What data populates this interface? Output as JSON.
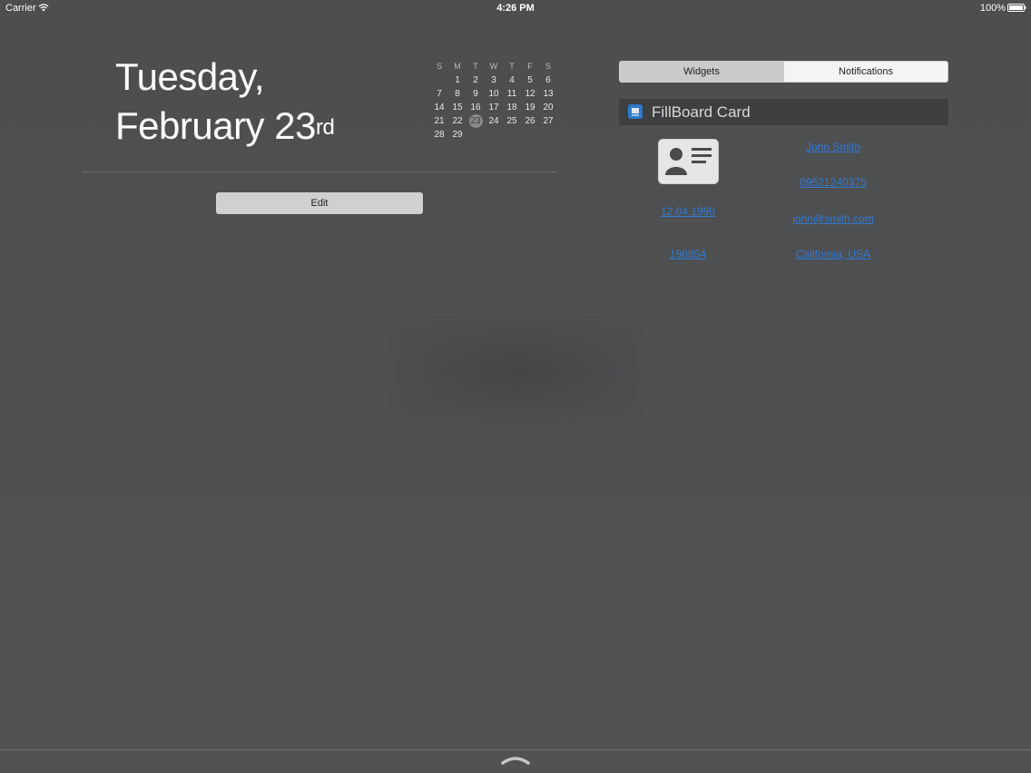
{
  "status_bar": {
    "carrier": "Carrier",
    "time": "4:26 PM",
    "battery": "100%"
  },
  "date": {
    "line1": "Tuesday,",
    "line2": "February 23",
    "suffix": "rd"
  },
  "calendar": {
    "weekdays": [
      "S",
      "M",
      "T",
      "W",
      "T",
      "F",
      "S"
    ],
    "days": [
      [
        "",
        "1",
        "2",
        "3",
        "4",
        "5",
        "6"
      ],
      [
        "7",
        "8",
        "9",
        "10",
        "11",
        "12",
        "13"
      ],
      [
        "14",
        "15",
        "16",
        "17",
        "18",
        "19",
        "20"
      ],
      [
        "21",
        "22",
        "23",
        "24",
        "25",
        "26",
        "27"
      ],
      [
        "28",
        "29",
        "",
        "",
        "",
        "",
        ""
      ]
    ],
    "today": "23"
  },
  "edit_button": "Edit",
  "tabs": {
    "widgets": "Widgets",
    "notifications": "Notifications"
  },
  "widget": {
    "title": "FillBoard Card",
    "fields": {
      "name": "John Smith",
      "phone": "09521240375",
      "dob": "12.04.1990",
      "email": "john@smith.com",
      "zip": "196854",
      "location": "California, USA"
    }
  },
  "colors": {
    "background": "#4f5052",
    "link": "#2f7ad6",
    "segment_active": "#c9cacc",
    "widget_header": "#3e3f41"
  },
  "icons": {
    "wifi": "wifi-icon",
    "battery": "battery-icon",
    "app": "fillboard-app-icon",
    "card": "contact-card-icon",
    "grabber": "chevron-up-icon"
  }
}
